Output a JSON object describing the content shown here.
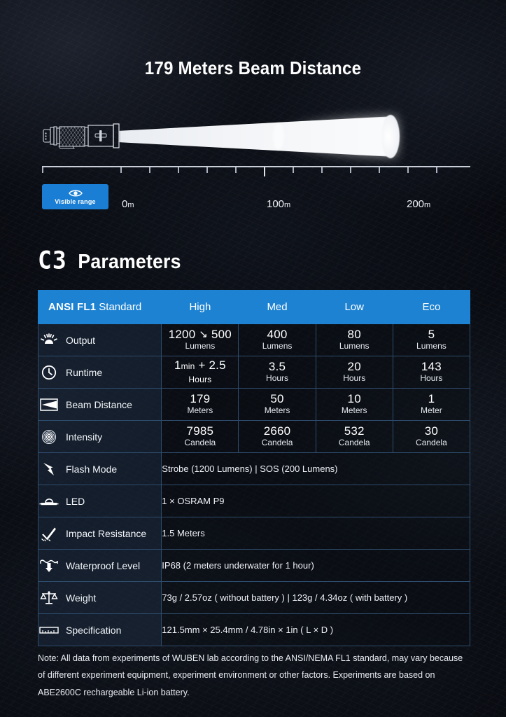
{
  "hero": {
    "headline": "179 Meters Beam Distance",
    "torch_icon": "flashlight-icon",
    "beam_icon": "light-beam-illustration"
  },
  "scale": {
    "visible_range": {
      "label": "Visible range",
      "icon": "eye-icon",
      "color": "#1a7fd4"
    },
    "ticks": [
      {
        "value": "0m",
        "number": "0",
        "unit": "m"
      },
      {
        "value": "100m",
        "number": "100",
        "unit": "m"
      },
      {
        "value": "200m",
        "number": "200",
        "unit": "m"
      }
    ],
    "range_min": 0,
    "range_max": 200,
    "unit": "m"
  },
  "section": {
    "model": "C3",
    "title_word": "Parameters"
  },
  "table": {
    "accent_color": "#1d82d2",
    "grid_color": "#2e4c6d",
    "header": {
      "standard_strong": "ANSI FL1",
      "standard_soft": "Standard",
      "modes": [
        "High",
        "Med",
        "Low",
        "Eco"
      ]
    },
    "rows": [
      {
        "label": "Output",
        "icon": "sunburst-icon",
        "type": "modes",
        "cells": [
          {
            "main": "1200 ↘ 500",
            "sub": "Lumens"
          },
          {
            "main": "400",
            "sub": "Lumens"
          },
          {
            "main": "80",
            "sub": "Lumens"
          },
          {
            "main": "5",
            "sub": "Lumens"
          }
        ]
      },
      {
        "label": "Runtime",
        "icon": "clock-icon",
        "type": "modes",
        "cells": [
          {
            "main": "1min + 2.5 Hours",
            "sub": ""
          },
          {
            "main": "3.5",
            "sub": "Hours"
          },
          {
            "main": "20",
            "sub": "Hours"
          },
          {
            "main": "143",
            "sub": "Hours"
          }
        ]
      },
      {
        "label": "Beam Distance",
        "icon": "beam-cone-icon",
        "type": "modes",
        "cells": [
          {
            "main": "179",
            "sub": "Meters"
          },
          {
            "main": "50",
            "sub": "Meters"
          },
          {
            "main": "10",
            "sub": "Meters"
          },
          {
            "main": "1",
            "sub": "Meter"
          }
        ]
      },
      {
        "label": "Intensity",
        "icon": "concentric-circles-icon",
        "type": "modes",
        "cells": [
          {
            "main": "7985",
            "sub": "Candela"
          },
          {
            "main": "2660",
            "sub": "Candela"
          },
          {
            "main": "532",
            "sub": "Candela"
          },
          {
            "main": "30",
            "sub": "Candela"
          }
        ]
      },
      {
        "label": "Flash Mode",
        "icon": "lightning-bolt-icon",
        "type": "wide",
        "value": "Strobe (1200 Lumens)  |  SOS (200 Lumens)"
      },
      {
        "label": "LED",
        "icon": "led-dome-icon",
        "type": "wide",
        "value": "1 × OSRAM P9"
      },
      {
        "label": "Impact Resistance",
        "icon": "impact-check-icon",
        "type": "wide",
        "value": "1.5 Meters"
      },
      {
        "label": "Waterproof Level",
        "icon": "waterproof-icon",
        "type": "wide",
        "value": "IP68  (2 meters underwater for 1 hour)"
      },
      {
        "label": "Weight",
        "icon": "balance-scale-icon",
        "type": "wide",
        "value": "73g / 2.57oz ( without battery )  |  123g / 4.34oz ( with battery )"
      },
      {
        "label": "Specification",
        "icon": "ruler-icon",
        "type": "wide",
        "value": "121.5mm × 25.4mm / 4.78in × 1in ( L × D )"
      }
    ]
  },
  "note": "Note: All data from experiments of WUBEN lab according to the ANSI/NEMA FL1 standard, may vary because of different experiment equipment, experiment environment or other factors. Experiments are based on ABE2600C rechargeable Li-ion battery."
}
